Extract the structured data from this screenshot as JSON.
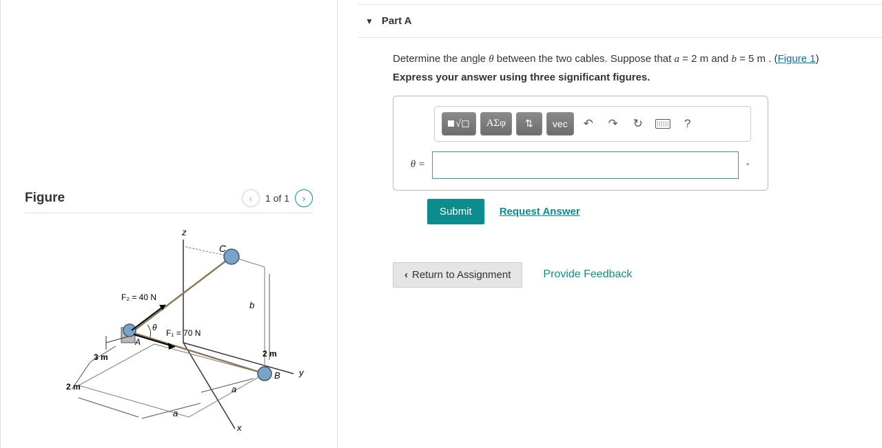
{
  "figure": {
    "title": "Figure",
    "nav_text": "1 of 1",
    "labels": {
      "z": "z",
      "x": "x",
      "y": "y",
      "C": "C",
      "A": "A",
      "B": "B",
      "theta": "θ",
      "F1": "F₁ = 70 N",
      "F2": "F₂ = 40 N",
      "dim_3m": "3 m",
      "dim_2m_left": "2 m",
      "dim_2m_right": "2 m",
      "dim_b": "b",
      "dim_a1": "a",
      "dim_a2": "a"
    }
  },
  "part": {
    "title": "Part A",
    "question_prefix": "Determine the angle ",
    "question_theta": "θ",
    "question_mid": " between the two cables. Suppose that ",
    "a_var": "a",
    "a_eq": " = 2  m ",
    "and": " and ",
    "b_var": "b",
    "b_eq": " = 5  m . (",
    "figure_link": "Figure 1",
    "close": ")",
    "instruction": "Express your answer using three significant figures.",
    "theta_eq": "θ =",
    "degree": "∘",
    "answer_value": ""
  },
  "toolbar": {
    "template": "■",
    "sqrt": "√◻",
    "greek": "ΑΣφ",
    "arrows": "⇅",
    "vec": "vec",
    "undo": "↶",
    "redo": "↷",
    "reset": "↻",
    "help": "?"
  },
  "buttons": {
    "submit": "Submit",
    "request": "Request Answer",
    "return": "Return to Assignment",
    "feedback": "Provide Feedback"
  }
}
